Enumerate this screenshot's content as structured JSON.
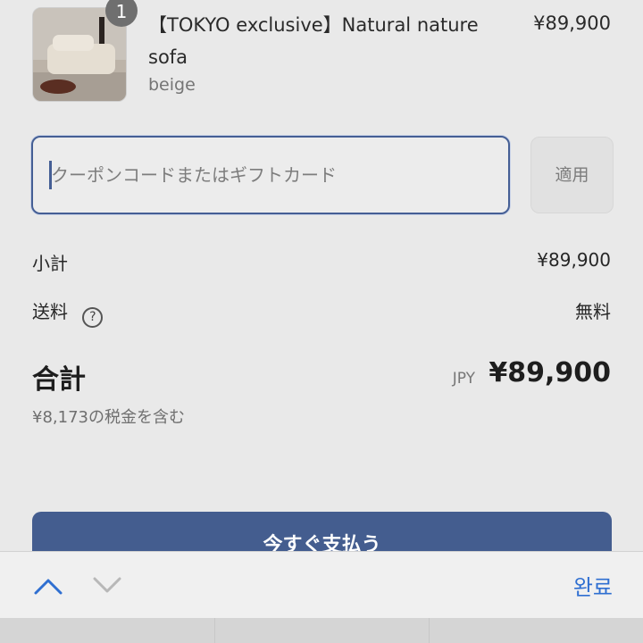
{
  "product": {
    "quantity": "1",
    "title": "【TOKYO exclusive】Natural nature sofa",
    "variant": "beige",
    "price": "¥89,900"
  },
  "coupon": {
    "placeholder": "クーポンコードまたはギフトカード",
    "apply_label": "適用"
  },
  "summary": {
    "subtotal_label": "小計",
    "subtotal_value": "¥89,900",
    "shipping_label": "送料",
    "shipping_value": "無料",
    "total_label": "合計",
    "currency": "JPY",
    "total_value": "¥89,900",
    "tax_note": "¥8,173の税金を含む"
  },
  "pay_button": {
    "label": "今すぐ支払う"
  },
  "keyboard_toolbar": {
    "done_label": "완료"
  },
  "colors": {
    "accent": "#445d8f",
    "toolbar_blue": "#2f6fd1"
  },
  "icons": [
    "product-thumbnail",
    "help-icon",
    "chevron-up-icon",
    "chevron-down-icon"
  ]
}
